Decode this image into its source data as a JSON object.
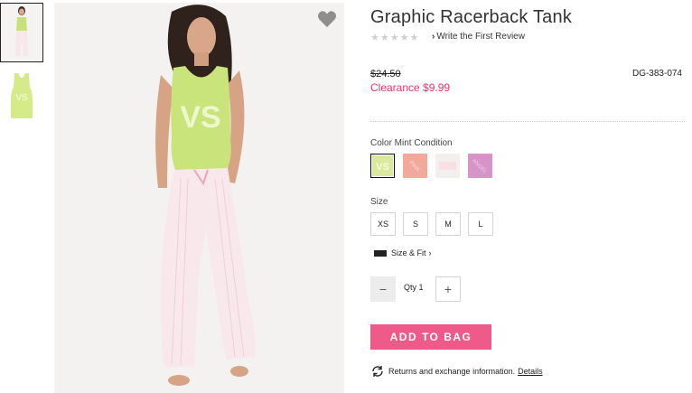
{
  "product": {
    "title": "Graphic Racerback Tank",
    "stars": "★★★★★",
    "review_link": "Write the First Review",
    "original_price": "$24.50",
    "clearance_price": "Clearance $9.99",
    "sku": "DG-383-074"
  },
  "color": {
    "label": "Color Mint Condition",
    "swatches": [
      {
        "name": "Mint Condition",
        "color": "#d9ea9c",
        "text_color": "#f4f8e0"
      },
      {
        "name": "Pink",
        "color": "#f0a99b",
        "text_color": "#fbd9d1"
      },
      {
        "name": "White",
        "color": "#f3efee",
        "text_color": "#e9a0ad"
      },
      {
        "name": "Lilac",
        "color": "#d694c8",
        "text_color": "#efcbe8"
      }
    ]
  },
  "size": {
    "label": "Size",
    "options": [
      "XS",
      "S",
      "M",
      "L"
    ]
  },
  "size_fit": "Size & Fit",
  "quantity": {
    "minus": "−",
    "label": "Qty 1",
    "plus": "+"
  },
  "add_to_bag": "ADD TO BAG",
  "returns": {
    "text": "Returns and exchange information.",
    "link": "Details"
  },
  "icons": {
    "heart": "heart-icon",
    "returns": "refresh-icon",
    "ruler": "ruler-icon"
  },
  "colors": {
    "accent_pink": "#e8336b",
    "button_pink": "#ee5a8a"
  }
}
